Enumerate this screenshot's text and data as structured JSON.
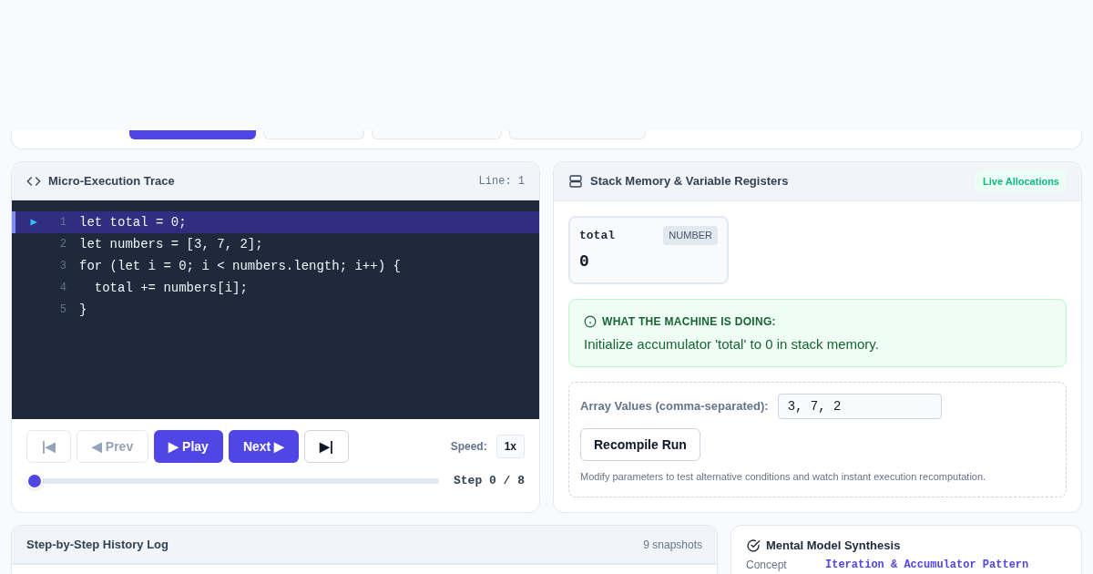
{
  "presets": [
    {
      "selected": true
    },
    {
      "selected": false
    },
    {
      "selected": false
    },
    {
      "selected": false
    }
  ],
  "trace": {
    "title": "Micro-Execution Trace",
    "line_label": "Line: 1",
    "lines": [
      {
        "number": "1",
        "code": "let total = 0;",
        "selected": true,
        "marker": "▶"
      },
      {
        "number": "2",
        "code": "let numbers = [3, 7, 2];",
        "selected": false
      },
      {
        "number": "3",
        "code": "for (let i = 0; i < numbers.length; i++) {",
        "selected": false
      },
      {
        "number": "4",
        "code": "  total += numbers[i];",
        "selected": false
      },
      {
        "number": "5",
        "code": "}",
        "selected": false
      }
    ],
    "buttons": [
      {
        "label": "|◀",
        "kind": "outline",
        "disabled": true
      },
      {
        "label": "◀ Prev",
        "kind": "outline",
        "disabled": true
      },
      {
        "label": "▶ Play",
        "kind": "primary",
        "disabled": false
      },
      {
        "label": "Next ▶",
        "kind": "primary",
        "disabled": false
      },
      {
        "label": "▶|",
        "kind": "outline",
        "disabled": false
      }
    ],
    "speed_label": "Speed:",
    "speed": "1x",
    "slider": {
      "level": 0
    },
    "step": "Step 0 / 8"
  },
  "memory": {
    "title": "Stack Memory & Variable Registers",
    "badge": "Live Allocations",
    "variables": [
      {
        "name": "total",
        "type": "NUMBER",
        "value": "0"
      }
    ],
    "explain": {
      "heading": "WHAT THE MACHINE IS DOING:",
      "text": "Initialize accumulator 'total' to 0 in stack memory."
    },
    "input": {
      "label": "Array Values (comma-separated):",
      "value": "3, 7, 2"
    },
    "button": "Recompile Run",
    "hint": "Modify parameters to test alternative conditions and watch instant execution recomputation."
  },
  "history": {
    "title": "Step-by-Step History Log",
    "count": "9 snapshots"
  },
  "synthesis": {
    "title": "Mental Model Synthesis",
    "rows": [
      {
        "label": "Concept",
        "value": "Iteration & Accumulator Pattern"
      }
    ]
  }
}
